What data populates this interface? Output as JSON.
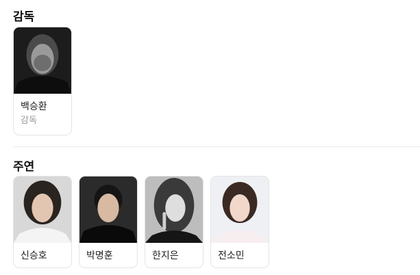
{
  "director_section": {
    "title": "감독",
    "people": [
      {
        "name": "백승환",
        "role": "감독"
      }
    ]
  },
  "cast_section": {
    "title": "주연",
    "people": [
      {
        "name": "신승호"
      },
      {
        "name": "박명훈"
      },
      {
        "name": "한지은"
      },
      {
        "name": "전소민"
      }
    ]
  },
  "colors": {
    "card_border": "#e4e4e4",
    "role_text": "#999999",
    "divider": "#ebebeb"
  }
}
